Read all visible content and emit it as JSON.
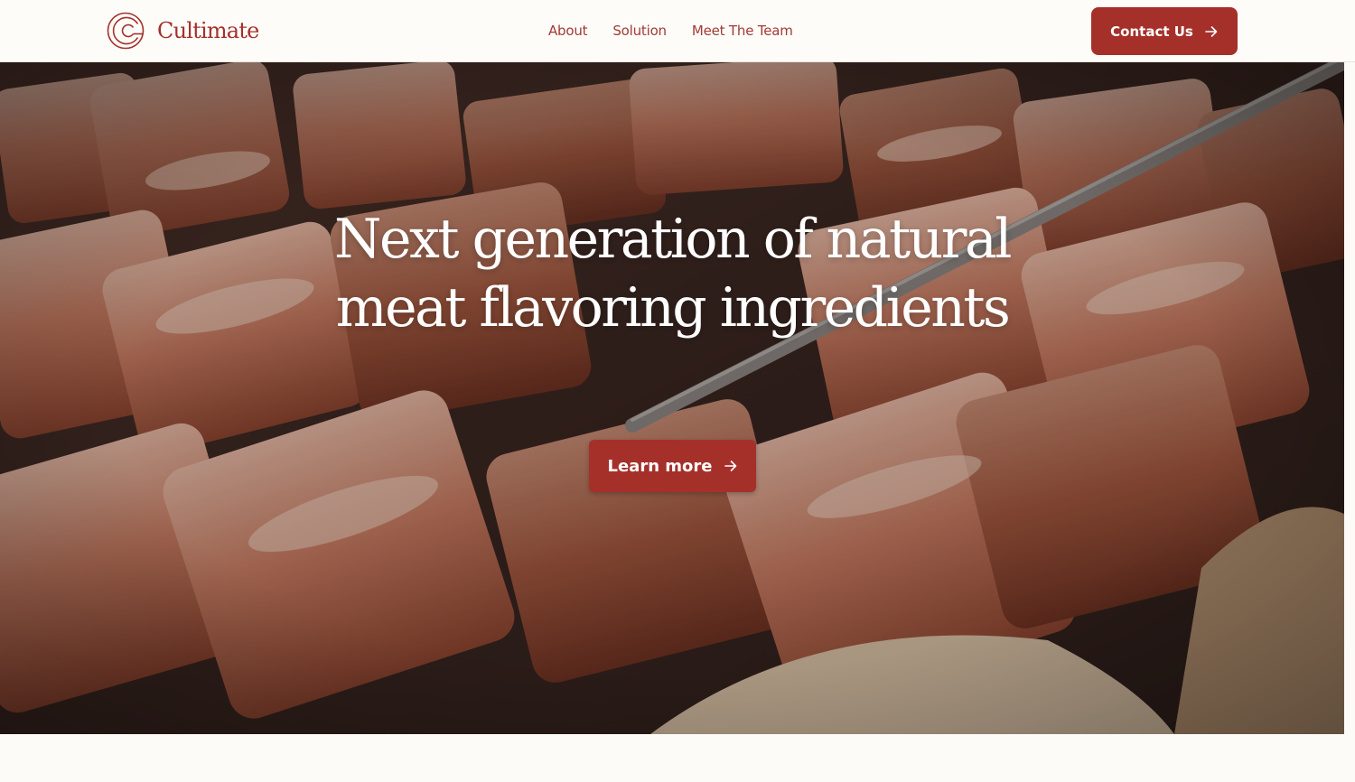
{
  "brand": {
    "name": "Cultimate",
    "logo_icon": "cultimate-logo-icon",
    "color": "#a5302a"
  },
  "nav": {
    "items": [
      {
        "label": "About"
      },
      {
        "label": "Solution"
      },
      {
        "label": "Meet The Team"
      }
    ],
    "contact_label": "Contact Us",
    "contact_icon": "arrow-right-icon"
  },
  "hero": {
    "title": "Next generation of natural meat flavoring ingredients",
    "cta_label": "Learn more",
    "cta_icon": "arrow-right-icon",
    "background_image": "grilled-pork-belly-photo"
  },
  "colors": {
    "accent": "#a5302a",
    "page_background": "#fcfbf8",
    "hero_text": "#ffffff"
  }
}
